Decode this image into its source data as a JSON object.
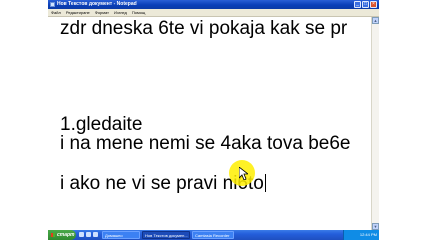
{
  "window": {
    "title": "Нов Текстов документ - Notepad",
    "controls": {
      "minimize": "_",
      "maximize": "□",
      "close": "×"
    }
  },
  "menu": [
    "Файл",
    "Редактиране",
    "Формат",
    "Изглед",
    "Помощ"
  ],
  "document": {
    "lines": [
      "zdr dneska 6te vi pokaja kak se pr",
      "1.gledaite",
      "i na mene nemi se 4aka tova be6e",
      "i ako ne vi se pravi ni6to"
    ]
  },
  "taskbar": {
    "start_label": "старт",
    "tasks": [
      "Домашно",
      "Нов Текстов докумен...",
      "Camtasia Recorder"
    ],
    "clock": "12:44 PM"
  },
  "colors": {
    "titlebar": "#0a3fb8",
    "taskbar": "#245edb",
    "start_button": "#3a9a3a",
    "cursor_highlight": "#ffee00"
  }
}
